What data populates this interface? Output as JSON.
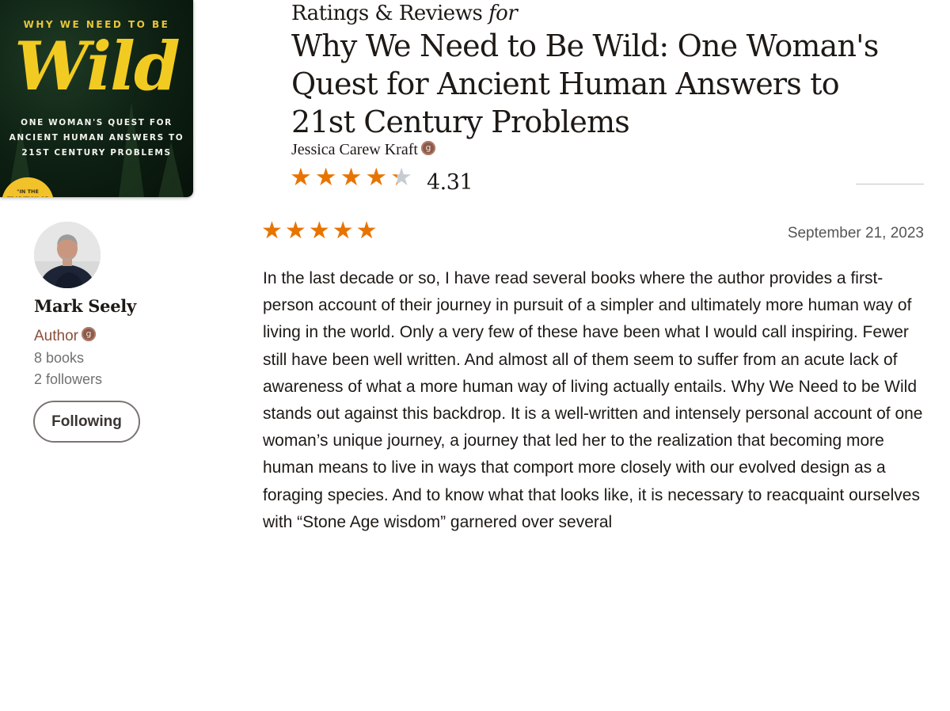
{
  "book": {
    "cover": {
      "kicker": "WHY WE NEED TO BE",
      "title_word": "Wild",
      "subtitle_line1": "ONE WOMAN'S QUEST FOR",
      "subtitle_line2": "ANCIENT HUMAN ANSWERS TO",
      "subtitle_line3": "21ST CENTURY PROBLEMS",
      "badge_text": "\"IN THE TRADITION OF"
    },
    "heading_label": "Ratings & Reviews",
    "heading_for": "for",
    "title": "Why We Need to Be Wild: One Woman's Quest for Ancient Human Answers to 21st Century Problems",
    "author": "Jessica Carew Kraft",
    "author_badge": "g",
    "average_rating": "4.31",
    "average_rating_value": 4.31,
    "star_glyph": "★"
  },
  "reviewer": {
    "name": "Mark Seely",
    "role": "Author",
    "role_badge": "g",
    "books": "8 books",
    "followers": "2 followers",
    "follow_button_label": "Following"
  },
  "review": {
    "rating_value": 5,
    "date": "September 21, 2023",
    "text": "In the last decade or so, I have read several books where the author provides a first-person account of their journey in pursuit of a simpler and ultimately more human way of living in the world. Only a very few of these have been what I would call inspiring. Fewer still have been well written. And almost all of them seem to suffer from an acute lack of awareness of what a more human way of living actually entails. Why We Need to be Wild stands out against this backdrop. It is a well-written and intensely personal account of one woman’s unique journey, a journey that led her to the realization that becoming more human means to live in ways that comport more closely with our evolved design as a foraging species. And to know what that looks like, it is necessary to reacquaint ourselves with “Stone Age wisdom” garnered over several"
  },
  "colors": {
    "star": "#e87400",
    "star_empty": "#c8ccd1",
    "author_role": "#8b4f3a",
    "cover_title": "#f2cb22"
  }
}
